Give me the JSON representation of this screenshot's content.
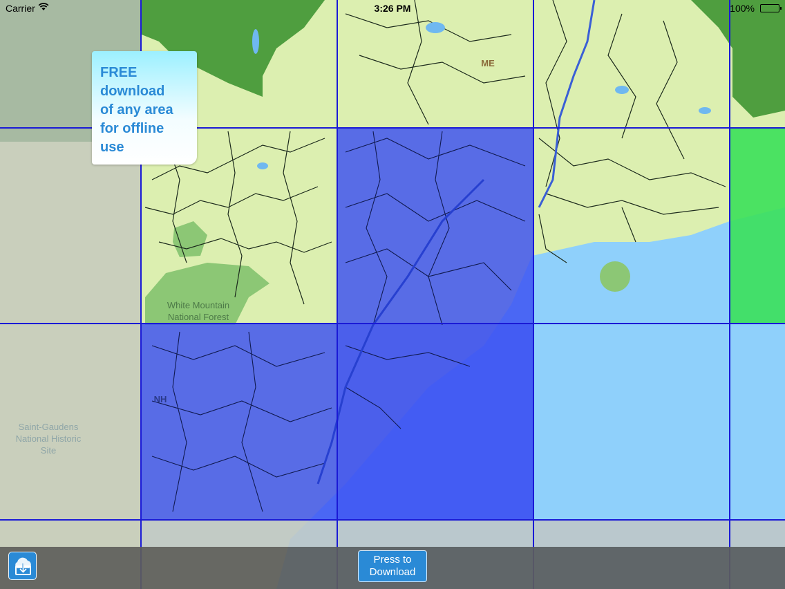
{
  "status_bar": {
    "carrier": "Carrier",
    "time": "3:26 PM",
    "battery": "100%"
  },
  "callout": {
    "lines": [
      "FREE",
      "download",
      "of any area",
      "for offline",
      "use"
    ]
  },
  "map": {
    "labels": {
      "state_me": "ME",
      "forest_line1": "White Mountain",
      "forest_line2": "National Forest",
      "state_nh": "NH",
      "historic_line1": "Saint-Gaudens",
      "historic_line2": "National Historic",
      "historic_line3": "Site"
    },
    "colors": {
      "land": "#dcefb0",
      "forest": "#7fc36a",
      "water": "#8fd0fb",
      "selected_tile": "#3b4ff2",
      "grid_line": "#1a1ad6",
      "green_tile": "#3be05a",
      "accent": "#2a8ad6"
    }
  },
  "toolbar": {
    "download_icon": "download-icon",
    "press_to_download_line1": "Press to",
    "press_to_download_line2": "Download"
  }
}
